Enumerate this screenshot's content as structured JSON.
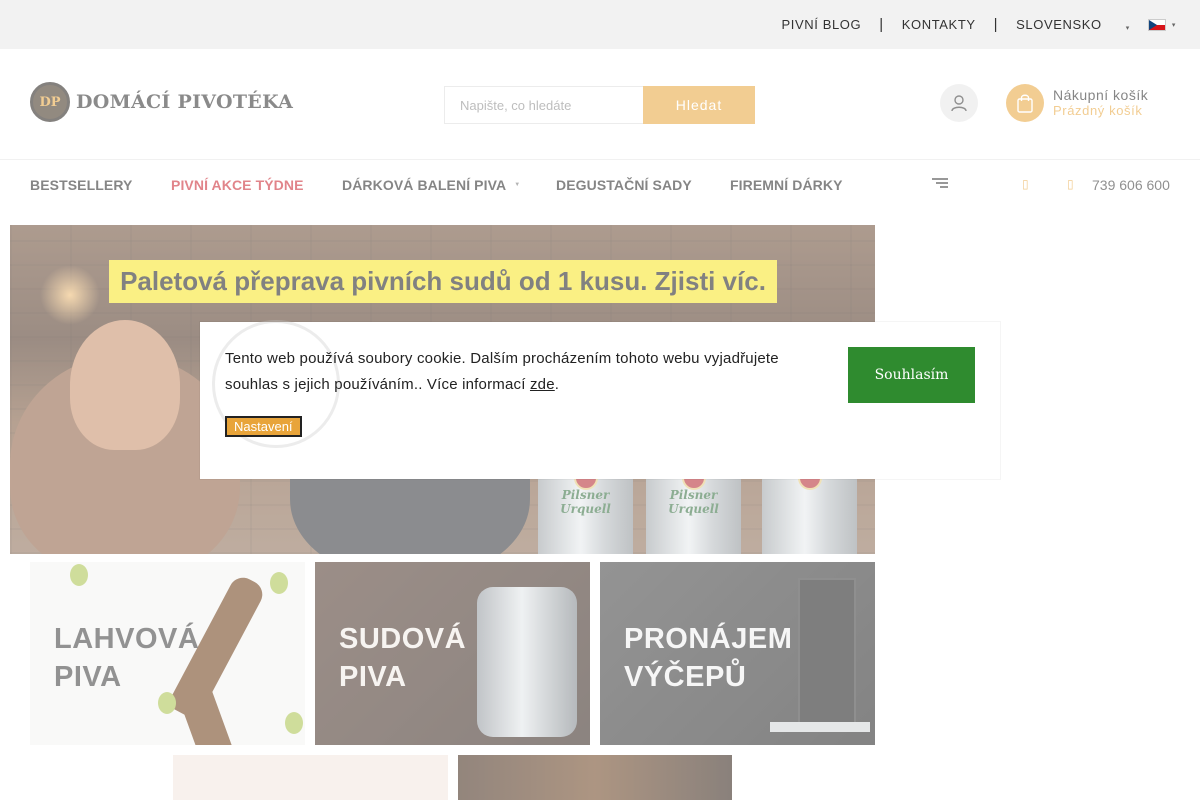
{
  "topbar": {
    "links": [
      "PIVNÍ BLOG",
      "KONTAKTY",
      "SLOVENSKO"
    ],
    "separator": "|",
    "language": "cz-flag-icon"
  },
  "header": {
    "logo_badge": "DP",
    "logo_text": "DOMÁCÍ PIVOTÉKA",
    "search": {
      "placeholder": "Napište, co hledáte",
      "value": "",
      "button": "Hledat"
    },
    "cart": {
      "title": "Nákupní košík",
      "status": "Prázdný košík"
    }
  },
  "nav": {
    "items": [
      {
        "label": "BESTSELLERY"
      },
      {
        "label": "PIVNÍ AKCE TÝDNE"
      },
      {
        "label": "DÁRKOVÁ BALENÍ PIVA"
      },
      {
        "label": "DEGUSTAČNÍ SADY"
      },
      {
        "label": "FIREMNÍ DÁRKY"
      }
    ],
    "phone": "739 606 600"
  },
  "hero": {
    "headline": "Paletová přeprava pivních sudů od 1 kusu. Zjisti víc.",
    "keg_brand": "Pilsner Urquell"
  },
  "tiles": [
    {
      "line1": "LAHVOVÁ",
      "line2": "PIVA"
    },
    {
      "line1": "SUDOVÁ",
      "line2": "PIVA"
    },
    {
      "line1": "PRONÁJEM",
      "line2": "VÝČEPŮ"
    }
  ],
  "cookie": {
    "text": "Tento web používá soubory cookie. Dalším procházením tohoto webu vyjadřujete souhlas s jejich používáním.. Více informací ",
    "link": "zde",
    "after_link": ".",
    "settings_button": "Nastavení",
    "accept_button": "Souhlasím"
  },
  "colors": {
    "accent": "#e8a43a",
    "sale": "#c8202a",
    "accept": "#2f8b2f"
  }
}
